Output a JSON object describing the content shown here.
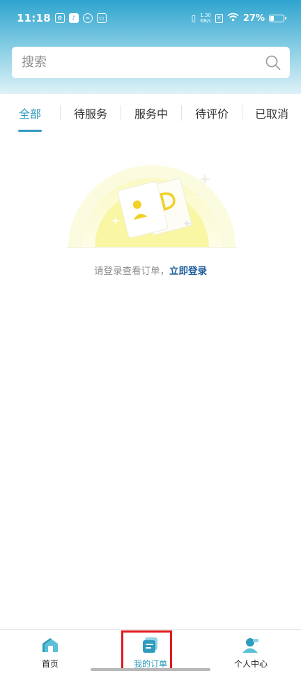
{
  "status_bar": {
    "time": "11:18",
    "net_speed_value": "1.30",
    "net_speed_unit": "KB/s",
    "battery_percent": "27%"
  },
  "search": {
    "placeholder": "搜索"
  },
  "tabs": [
    {
      "label": "全部",
      "active": true
    },
    {
      "label": "待服务",
      "active": false
    },
    {
      "label": "服务中",
      "active": false
    },
    {
      "label": "待评价",
      "active": false
    },
    {
      "label": "已取消",
      "active": false
    }
  ],
  "empty_state": {
    "message": "请登录查看订单，",
    "login_link": "立即登录"
  },
  "bottom_nav": [
    {
      "label": "首页",
      "icon": "home-icon",
      "active": false
    },
    {
      "label": "我的订单",
      "icon": "orders-icon",
      "active": true
    },
    {
      "label": "个人中心",
      "icon": "profile-icon",
      "active": false
    }
  ],
  "colors": {
    "accent": "#2f9bbd",
    "link": "#1d5d9a",
    "highlight": "#e0191f"
  }
}
